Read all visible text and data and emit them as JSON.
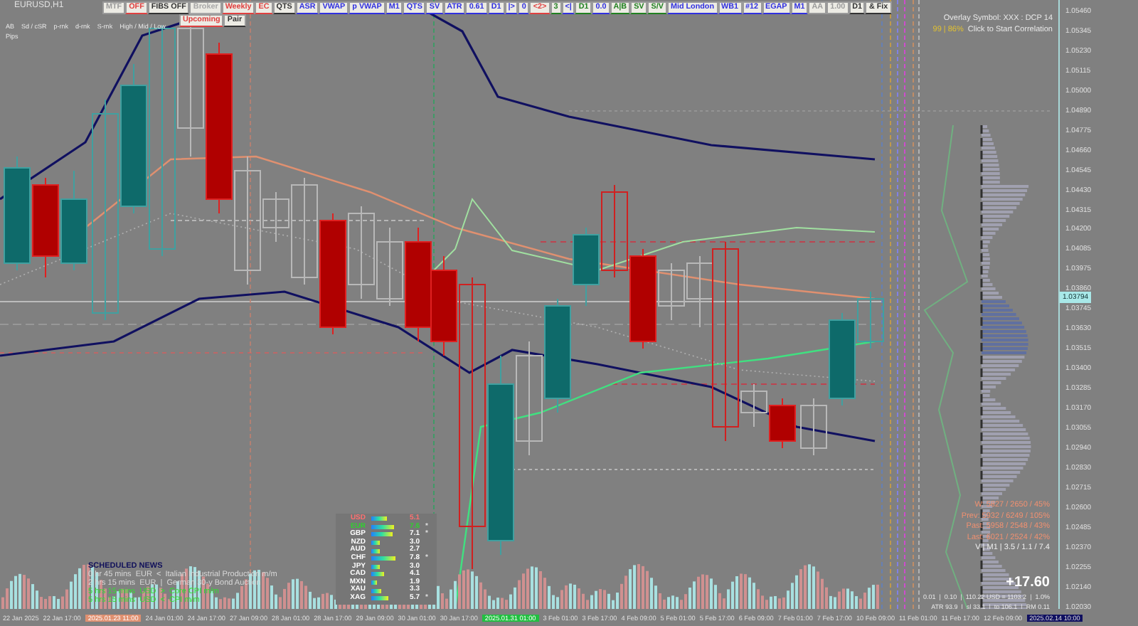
{
  "chart": {
    "symbol": "EURUSD,H1"
  },
  "toolbar": {
    "buttons": [
      {
        "label": "MTF",
        "color": "#9a9a9a"
      },
      {
        "label": "OFF",
        "color": "#e04040"
      },
      {
        "label": "FIBS OFF",
        "color": "#333333"
      },
      {
        "label": "Broker",
        "color": "#a8a8a8"
      },
      {
        "label": "Weekly",
        "color": "#e04040"
      },
      {
        "label": "EC",
        "color": "#e04040"
      },
      {
        "label": "QTS",
        "color": "#333333"
      },
      {
        "label": "ASR",
        "color": "#3030e0"
      },
      {
        "label": "VWAP",
        "color": "#3030e0"
      },
      {
        "label": "p VWAP",
        "color": "#3030e0"
      },
      {
        "label": "M1",
        "color": "#3030e0"
      },
      {
        "label": "QTS",
        "color": "#3030e0"
      },
      {
        "label": "SV",
        "color": "#3030e0"
      },
      {
        "label": "ATR",
        "color": "#3030e0"
      },
      {
        "label": "0.61",
        "color": "#3030e0"
      },
      {
        "label": "D1",
        "color": "#3030e0"
      },
      {
        "label": "|>",
        "color": "#3030e0"
      },
      {
        "label": "0",
        "color": "#3030e0"
      },
      {
        "label": "<2>",
        "color": "#e04040"
      },
      {
        "label": "3",
        "color": "#208020"
      },
      {
        "label": "<|",
        "color": "#3030e0"
      },
      {
        "label": "D1",
        "color": "#208020"
      },
      {
        "label": "0.0",
        "color": "#3030e0"
      },
      {
        "label": "A|B",
        "color": "#208020"
      },
      {
        "label": "SV",
        "color": "#208020"
      },
      {
        "label": "S/V",
        "color": "#208020"
      },
      {
        "label": "Mid London",
        "color": "#3030e0"
      },
      {
        "label": "WB1",
        "color": "#3030e0"
      },
      {
        "label": "#12",
        "color": "#3030e0"
      },
      {
        "label": "EGAP",
        "color": "#3030e0"
      },
      {
        "label": "M1",
        "color": "#3030e0"
      },
      {
        "label": "AA",
        "color": "#9a9a9a"
      },
      {
        "label": "1.00",
        "color": "#9a9a9a"
      },
      {
        "label": "D1",
        "color": "#333333"
      },
      {
        "label": "& Fix",
        "color": "#333333"
      }
    ],
    "sub_buttons": [
      {
        "label": "Upcoming",
        "color": "#e04040"
      },
      {
        "label": "Pair",
        "color": "#333333"
      }
    ]
  },
  "info": {
    "labels": [
      "AB",
      "Sd / cSR",
      "p-rnk",
      "d-rnk",
      "S-rnk",
      "High / Mid / Low"
    ],
    "row_label": "Pips"
  },
  "overlay": {
    "title": "Overlay Symbol: XXX : DCP 14",
    "score": "99 | 86%",
    "action": "Click to Start Correlation"
  },
  "strength": [
    {
      "currency": "USD",
      "value": "5.1",
      "color": "#ff7070"
    },
    {
      "currency": "EUR",
      "value": "7.6",
      "flag": "*",
      "color": "#30d030"
    },
    {
      "currency": "GBP",
      "value": "7.1",
      "flag": "*",
      "color": "#ffffff"
    },
    {
      "currency": "NZD",
      "value": "3.0",
      "color": "#ffffff"
    },
    {
      "currency": "AUD",
      "value": "2.7",
      "color": "#ffffff"
    },
    {
      "currency": "CHF",
      "value": "7.8",
      "flag": "*",
      "color": "#ffffff"
    },
    {
      "currency": "JPY",
      "value": "3.0",
      "color": "#ffffff"
    },
    {
      "currency": "CAD",
      "value": "4.1",
      "color": "#ffffff"
    },
    {
      "currency": "MXN",
      "value": "1.9",
      "color": "#ffffff"
    },
    {
      "currency": "XAU",
      "value": "3.3",
      "color": "#ffffff"
    },
    {
      "currency": "XAG",
      "value": "5.7",
      "flag": "*",
      "color": "#ffffff"
    }
  ],
  "news": {
    "title": "SCHEDULED NEWS",
    "items": [
      {
        "text": "0 hr 45 mins  EUR  <  Italian Industrial Production m/m",
        "color": "#d8d8d8"
      },
      {
        "text": "2 hrs 15 mins  EUR  |  German 30-y Bond Auction",
        "color": "#d8d8d8"
      },
      {
        "text": "5 hrs 15 mins  USD  >  Core CPI m/m",
        "color": "#30e030"
      },
      {
        "text": "5 hrs 15 mins  USD  <  CPI m/m",
        "color": "#30e030"
      }
    ]
  },
  "stats": {
    "lines": [
      "W: 5827 / 2650 / 45%",
      "Prev: 5932 / 6249 / 105%",
      "Past: 5958 / 2548 / 43%",
      "Last: 6021 / 2524 / 42%"
    ],
    "volume": "V | M1 | 3.5 / 1.1 / 7.4",
    "pnl": "+17.60",
    "risk": "0.01  |  0.10  |  110.22 USD = 1103.2  |  1.0%",
    "atr": "ATR 93.9  |  sl 33.1  |  tp 106.1  |  RM 0.11"
  },
  "price_axis": {
    "labels": [
      "1.05460",
      "1.05345",
      "1.05230",
      "1.05115",
      "1.05000",
      "1.04890",
      "1.04775",
      "1.04660",
      "1.04545",
      "1.04430",
      "1.04315",
      "1.04200",
      "1.04085",
      "1.03975",
      "1.03860",
      "1.03745",
      "1.03630",
      "1.03515",
      "1.03400",
      "1.03285",
      "1.03170",
      "1.03055",
      "1.02940",
      "1.02830",
      "1.02715",
      "1.02600",
      "1.02485",
      "1.02370",
      "1.02255",
      "1.02140",
      "1.02030"
    ],
    "current": "1.03794"
  },
  "time_axis": [
    {
      "label": "22 Jan 2025"
    },
    {
      "label": "22 Jan 17:00"
    },
    {
      "label": "2025.01.23 11:00",
      "kind": "orange"
    },
    {
      "label": "24 Jan 01:00"
    },
    {
      "label": "24 Jan 17:00"
    },
    {
      "label": "27 Jan 09:00"
    },
    {
      "label": "28 Jan 01:00"
    },
    {
      "label": "28 Jan 17:00"
    },
    {
      "label": "29 Jan 09:00"
    },
    {
      "label": "30 Jan 01:00"
    },
    {
      "label": "30 Jan 17:00"
    },
    {
      "label": "2025.01.31 01:00",
      "kind": "green"
    },
    {
      "label": "3 Feb 01:00"
    },
    {
      "label": "3 Feb 17:00"
    },
    {
      "label": "4 Feb 09:00"
    },
    {
      "label": "5 Feb 01:00"
    },
    {
      "label": "5 Feb 17:00"
    },
    {
      "label": "6 Feb 09:00"
    },
    {
      "label": "7 Feb 01:00"
    },
    {
      "label": "7 Feb 17:00"
    },
    {
      "label": "10 Feb 09:00"
    },
    {
      "label": "11 Feb 01:00"
    },
    {
      "label": "11 Feb 17:00"
    },
    {
      "label": "12 Feb 09:00"
    },
    {
      "label": "2025.02.14 10:00",
      "kind": "navy"
    }
  ]
}
